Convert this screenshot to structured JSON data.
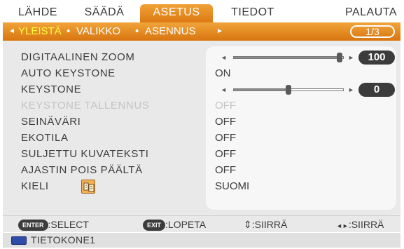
{
  "tabs": [
    {
      "label": "LÄHDE",
      "active": false
    },
    {
      "label": "SÄÄDÄ",
      "active": false
    },
    {
      "label": "ASETUS",
      "active": true
    },
    {
      "label": "TIEDOT",
      "active": false
    },
    {
      "label": "PALAUTA",
      "active": false
    }
  ],
  "subtabs": {
    "items": [
      {
        "label": "YLEISTÄ",
        "active": true
      },
      {
        "label": "VALIKKO",
        "active": false
      },
      {
        "label": "ASENNUS",
        "active": false
      }
    ],
    "bullet": "•",
    "left_arrow": "◄",
    "right_arrow": "►",
    "page": "1/3"
  },
  "rows": [
    {
      "label": "DIGITAALINEN ZOOM",
      "type": "slider",
      "value": "100",
      "level": 0.97,
      "enabled": true
    },
    {
      "label": "AUTO KEYSTONE",
      "type": "text",
      "value": "ON",
      "enabled": true
    },
    {
      "label": "KEYSTONE",
      "type": "slider",
      "value": "0",
      "level": 0.5,
      "enabled": true
    },
    {
      "label": "KEYSTONE TALLENNUS",
      "type": "text",
      "value": "OFF",
      "enabled": false
    },
    {
      "label": "SEINÄVÄRI",
      "type": "text",
      "value": "OFF",
      "enabled": true
    },
    {
      "label": "EKOTILA",
      "type": "text",
      "value": "OFF",
      "enabled": true
    },
    {
      "label": "SULJETTU KUVATEKSTI",
      "type": "text",
      "value": "OFF",
      "enabled": true
    },
    {
      "label": "AJASTIN POIS PÄÄLTÄ",
      "type": "text",
      "value": "OFF",
      "enabled": true
    },
    {
      "label": "KIELI",
      "type": "text",
      "value": "SUOMI",
      "enabled": true,
      "icon": "language-icon"
    }
  ],
  "slider_arrows": {
    "left": "◄",
    "right": "►"
  },
  "help": {
    "enter_key": "ENTER",
    "enter_label": ":SELECT",
    "exit_key": "EXIT",
    "exit_label": ":LOPETA",
    "move_symbol": "⇕",
    "move_label": ":SIIRRÄ",
    "adjust_symbol": "◄►",
    "adjust_label": ":SIIRRÄ"
  },
  "source": {
    "icon": "computer-input-icon",
    "label": "TIETOKONE1"
  },
  "colors": {
    "accent": "#e88a1e",
    "highlight": "#fffc3c",
    "disabled": "#c4c4c4"
  }
}
